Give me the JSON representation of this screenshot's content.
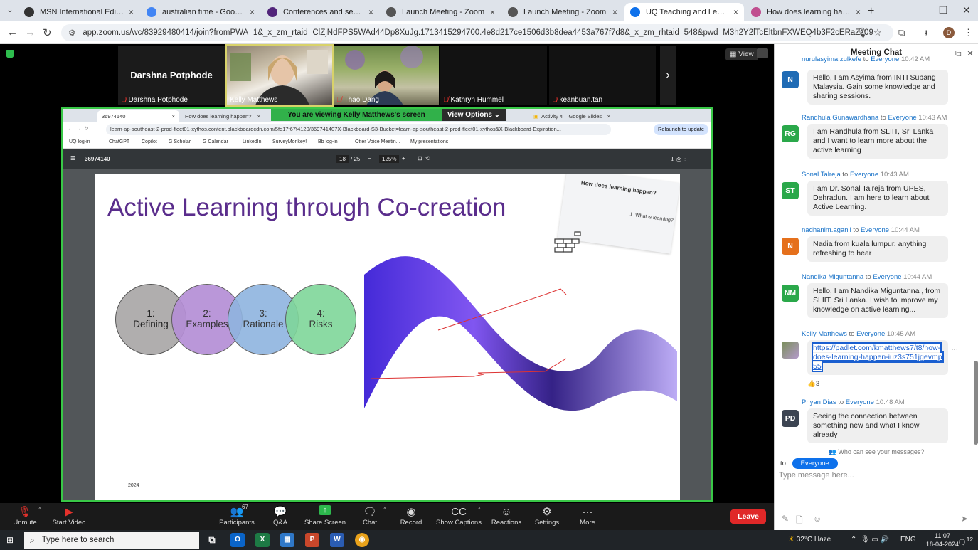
{
  "browser": {
    "tabs": [
      {
        "title": "MSN International Edition - W",
        "icon": "msn-icon",
        "color": "#333333"
      },
      {
        "title": "australian time - Google Searc",
        "icon": "google-icon",
        "color": "#4285f4"
      },
      {
        "title": "Conferences and seminars - Gr",
        "icon": "uq-shield-icon",
        "color": "#51247a"
      },
      {
        "title": "Launch Meeting - Zoom",
        "icon": "globe-icon",
        "color": "#555555"
      },
      {
        "title": "Launch Meeting - Zoom",
        "icon": "globe-icon",
        "color": "#555555"
      },
      {
        "title": "UQ Teaching and Learning",
        "icon": "zoom-icon",
        "color": "#0e71eb"
      },
      {
        "title": "How does learning happen?",
        "icon": "padlet-icon",
        "color": "#c04e8f"
      }
    ],
    "url": "app.zoom.us/wc/83929480414/join?fromPWA=1&_x_zm_rtaid=ClZjNdFPS5WAd44Dp8XuJg.1713415294700.4e8d217ce1506d3b8dea4453a767f7d8&_x_zm_rhtaid=548&pwd=M3h2Y2lTcEltbnFXWEQ4b3F2cERaZz09",
    "profile_initial": "D"
  },
  "zoom": {
    "participants_strip": [
      {
        "name": "Darshna Potphode",
        "big_name": "Darshna Potphode",
        "muted": true,
        "video": false
      },
      {
        "name": "Kelly Matthews",
        "muted": false,
        "video": true
      },
      {
        "name": "Thao Dang",
        "muted": true,
        "video": true
      },
      {
        "name": "Kathryn Hummel",
        "muted": true,
        "video": false
      },
      {
        "name": "keanbuan.tan",
        "muted": true,
        "video": false
      }
    ],
    "view_label": "View",
    "viewing_banner": "You are viewing  Kelly Matthews's screen",
    "view_options": "View Options",
    "toolbar": {
      "unmute": "Unmute",
      "start_video": "Start Video",
      "participants": "Participants",
      "participants_count": "67",
      "qa": "Q&A",
      "share_screen": "Share Screen",
      "chat": "Chat",
      "record": "Record",
      "captions": "Show Captions",
      "reactions": "Reactions",
      "settings": "Settings",
      "more": "More",
      "leave": "Leave"
    }
  },
  "shared": {
    "tabs": [
      "36974140",
      "How does learning happen?",
      "Activity 4 – Google Slides"
    ],
    "url": "learn-ap-southeast-2-prod-fleet01-xythos.content.blackboardcdn.com/5fd17f67f4120/369741407X-Blackboard-S3-Bucket=learn-ap-southeast-2-prod-fleet01-xythos&X-Blackboard-Expiration...",
    "relaunch": "Relaunch to update",
    "bookmarks": [
      "UQ log-in",
      "ChatGPT",
      "Copilot",
      "G Scholar",
      "G Calendar",
      "LinkedIn",
      "SurveyMonkey!",
      "Bb log-in",
      "Otter Voice Meetin...",
      "My presentations"
    ],
    "pdf": {
      "doc_id": "36974140",
      "page": "18",
      "total": "/ 25",
      "zoom": "125%"
    },
    "slide": {
      "title": "Active Learning through Co-creation",
      "circles": [
        {
          "label": "1:\nDefining",
          "color": "#b0aeae"
        },
        {
          "label": "2:\nExamples",
          "color": "#b58fd6"
        },
        {
          "label": "3:\nRationale",
          "color": "#8fb4df"
        },
        {
          "label": "4:\nRisks",
          "color": "#7fd69a"
        }
      ],
      "year": "2024",
      "sticky_title": "How does learning happen?",
      "sticky_item": "1. What is learning?"
    }
  },
  "chat": {
    "title": "Meeting Chat",
    "messages": [
      {
        "sender": "nurulasyima.zulkefe",
        "to": "to",
        "audience": "Everyone",
        "time": "10:42 AM",
        "initials": "N",
        "color": "#1f6bb5",
        "text": "Hello, I am Asyima from INTI Subang Malaysia. Gain some knowledge and sharing sessions."
      },
      {
        "sender": "Randhula Gunawardhana",
        "to": "to",
        "audience": "Everyone",
        "time": "10:43 AM",
        "initials": "RG",
        "color": "#2aa84a",
        "text": "I am Randhula from SLIIT, Sri Lanka and I want to learn more about the active learning"
      },
      {
        "sender": "Sonal Talreja",
        "to": "to",
        "audience": "Everyone",
        "time": "10:43 AM",
        "initials": "ST",
        "color": "#2aa84a",
        "text": "I am Dr. Sonal Talreja from UPES, Dehradun. I am here to learn about Active Learning."
      },
      {
        "sender": "nadhanim.aganii",
        "to": "to",
        "audience": "Everyone",
        "time": "10:44 AM",
        "initials": "N",
        "color": "#e5701c",
        "text": "Nadia from kuala lumpur. anything refreshing to hear"
      },
      {
        "sender": "Nandika Miguntanna",
        "to": "to",
        "audience": "Everyone",
        "time": "10:44 AM",
        "initials": "NM",
        "color": "#2aa84a",
        "text": "Hello, I am Nandika Miguntanna , from SLIIT, Sri Lanka. I wish to improve my knowledge on active learning..."
      },
      {
        "sender": "Kelly Matthews",
        "to": "to",
        "audience": "Everyone",
        "time": "10:45 AM",
        "initials": "",
        "color": "#6b6b8a",
        "link": "https://padlet.com/kmatthews7/t8/how-does-learning-happen-iuz3s751jgevmp55",
        "reaction": "👍3"
      },
      {
        "sender": "Priyan Dias",
        "to": "to",
        "audience": "Everyone",
        "time": "10:48 AM",
        "initials": "PD",
        "color": "#3c4452",
        "text": "Seeing the connection between something new and what I know already"
      }
    ],
    "who_can_see": "Who can see your messages?",
    "to_label": "to:",
    "audience": "Everyone",
    "placeholder": "Type message here..."
  },
  "taskbar": {
    "search_placeholder": "Type here to search",
    "weather": "32°C  Haze",
    "lang": "ENG",
    "time": "11:07",
    "date": "18-04-2024",
    "notif_count": "12"
  }
}
